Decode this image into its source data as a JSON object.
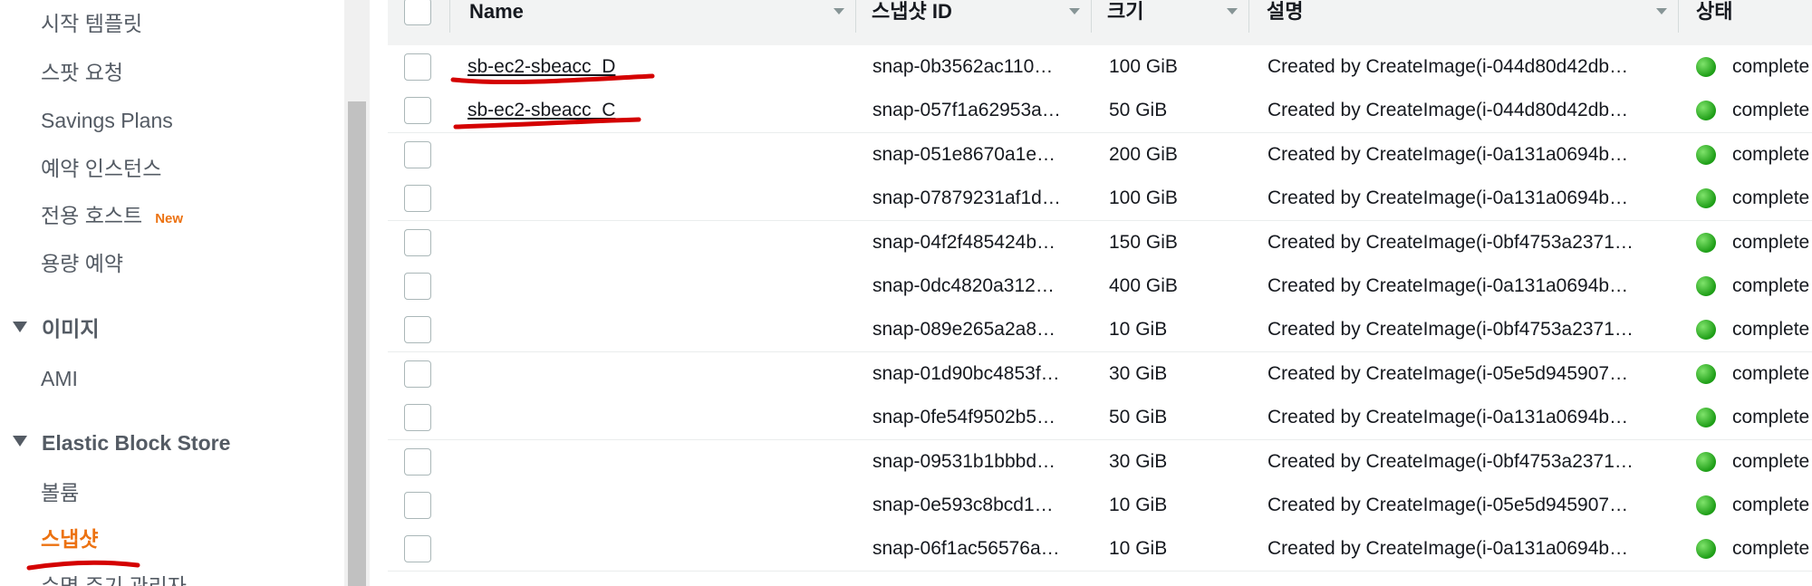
{
  "sidebar": {
    "items_top": [
      {
        "label": "시작 템플릿"
      },
      {
        "label": "스팟 요청"
      },
      {
        "label": "Savings Plans"
      },
      {
        "label": "예약 인스턴스"
      },
      {
        "label": "전용 호스트",
        "badge": "New"
      },
      {
        "label": "용량 예약"
      }
    ],
    "section_images": {
      "title": "이미지",
      "items": [
        {
          "label": "AMI"
        }
      ]
    },
    "section_ebs": {
      "title": "Elastic Block Store",
      "items": [
        {
          "label": "볼륨"
        },
        {
          "label": "스냅샷",
          "active": true
        },
        {
          "label": "수명 주기 관리자"
        }
      ]
    }
  },
  "table": {
    "columns": [
      "Name",
      "스냅샷 ID",
      "크기",
      "설명",
      "상태"
    ],
    "rows": [
      {
        "name": "sb-ec2-sbeacc_D",
        "snapshot_id": "snap-0b3562ac110…",
        "size": "100 GiB",
        "description": "Created by CreateImage(i-044d80d42db…",
        "status": "complete"
      },
      {
        "name": "sb-ec2-sbeacc_C",
        "snapshot_id": "snap-057f1a62953a…",
        "size": "50 GiB",
        "description": "Created by CreateImage(i-044d80d42db…",
        "status": "complete"
      },
      {
        "name": "",
        "snapshot_id": "snap-051e8670a1e…",
        "size": "200 GiB",
        "description": "Created by CreateImage(i-0a131a0694b…",
        "status": "complete"
      },
      {
        "name": "",
        "snapshot_id": "snap-07879231af1d…",
        "size": "100 GiB",
        "description": "Created by CreateImage(i-0a131a0694b…",
        "status": "complete"
      },
      {
        "name": "",
        "snapshot_id": "snap-04f2f485424b…",
        "size": "150 GiB",
        "description": "Created by CreateImage(i-0bf4753a2371…",
        "status": "complete"
      },
      {
        "name": "",
        "snapshot_id": "snap-0dc4820a312…",
        "size": "400 GiB",
        "description": "Created by CreateImage(i-0a131a0694b…",
        "status": "complete"
      },
      {
        "name": "",
        "snapshot_id": "snap-089e265a2a8…",
        "size": "10 GiB",
        "description": "Created by CreateImage(i-0bf4753a2371…",
        "status": "complete"
      },
      {
        "name": "",
        "snapshot_id": "snap-01d90bc4853f…",
        "size": "30 GiB",
        "description": "Created by CreateImage(i-05e5d945907…",
        "status": "complete"
      },
      {
        "name": "",
        "snapshot_id": "snap-0fe54f9502b5…",
        "size": "50 GiB",
        "description": "Created by CreateImage(i-0a131a0694b…",
        "status": "complete"
      },
      {
        "name": "",
        "snapshot_id": "snap-09531b1bbbd…",
        "size": "30 GiB",
        "description": "Created by CreateImage(i-0bf4753a2371…",
        "status": "complete"
      },
      {
        "name": "",
        "snapshot_id": "snap-0e593c8bcd1…",
        "size": "10 GiB",
        "description": "Created by CreateImage(i-05e5d945907…",
        "status": "complete"
      },
      {
        "name": "",
        "snapshot_id": "snap-06f1ac56576a…",
        "size": "10 GiB",
        "description": "Created by CreateImage(i-0a131a0694b…",
        "status": "complete"
      }
    ]
  },
  "colors": {
    "accent_orange": "#ec7211",
    "annotation_red": "#d40000",
    "status_green": "#1d9d16"
  }
}
